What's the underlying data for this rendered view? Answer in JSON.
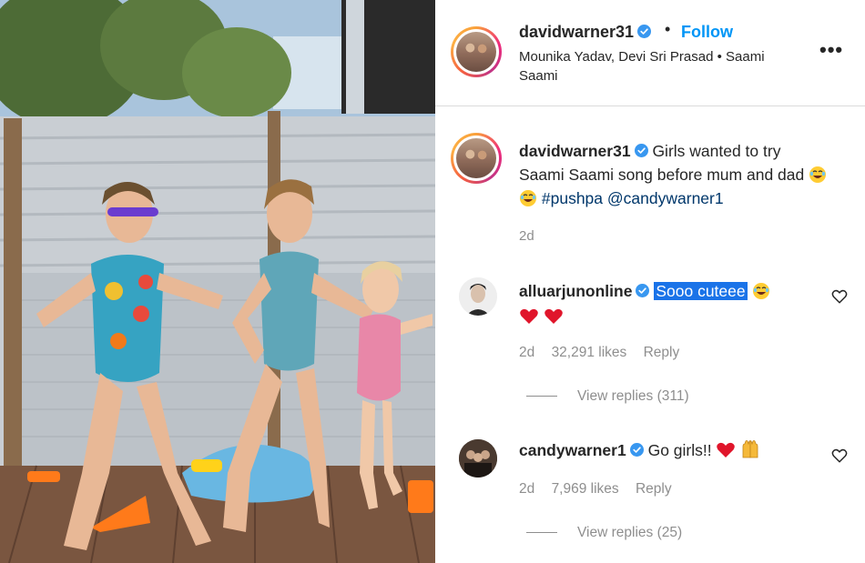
{
  "post": {
    "header": {
      "username": "davidwarner31",
      "separator": "•",
      "follow_label": "Follow",
      "audio": "Mounika Yadav, Devi Sri Prasad • Saami Saami",
      "more_label": "•••"
    },
    "caption": {
      "username": "davidwarner31",
      "text": "Girls wanted to try Saami Saami song before mum and dad",
      "hashtag": "#pushpa",
      "mention": "@candywarner1",
      "time": "2d"
    },
    "comments": [
      {
        "username": "alluarjunonline",
        "text": "Sooo cuteee",
        "time": "2d",
        "likes": "32,291 likes",
        "reply_label": "Reply",
        "view_replies": "View replies (311)"
      },
      {
        "username": "candywarner1",
        "text": "Go girls!!",
        "time": "2d",
        "likes": "7,969 likes",
        "reply_label": "Reply",
        "view_replies": "View replies (25)"
      }
    ]
  },
  "colors": {
    "link_blue": "#0095f6",
    "verified_blue": "#3897f0",
    "heart_red": "#ed4956",
    "selection": "#1a73e8",
    "muted_text": "#8e8e8e"
  },
  "icons": [
    "verified-badge-icon",
    "more-options-icon",
    "heart-outline-icon",
    "laughing-emoji-icon",
    "red-heart-emoji-icon",
    "raised-hands-emoji-icon"
  ]
}
